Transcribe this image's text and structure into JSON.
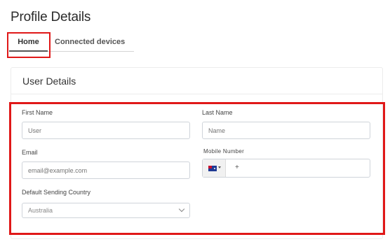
{
  "page": {
    "title": "Profile Details"
  },
  "tabs": [
    {
      "label": "Home",
      "active": true
    },
    {
      "label": "Connected devices",
      "active": false
    }
  ],
  "card": {
    "title": "User Details"
  },
  "form": {
    "first_name": {
      "label": "First Name",
      "placeholder": "User"
    },
    "last_name": {
      "label": "Last Name",
      "placeholder": "Name"
    },
    "email": {
      "label": "Email",
      "placeholder": "email@example.com"
    },
    "mobile": {
      "label": "Mobile Number",
      "dial_code": "+",
      "flag_icon": "australia-flag-icon"
    },
    "country": {
      "label": "Default Sending Country",
      "value": "Australia"
    }
  },
  "colors": {
    "highlight": "#e01818",
    "border": "#cfd4da"
  }
}
